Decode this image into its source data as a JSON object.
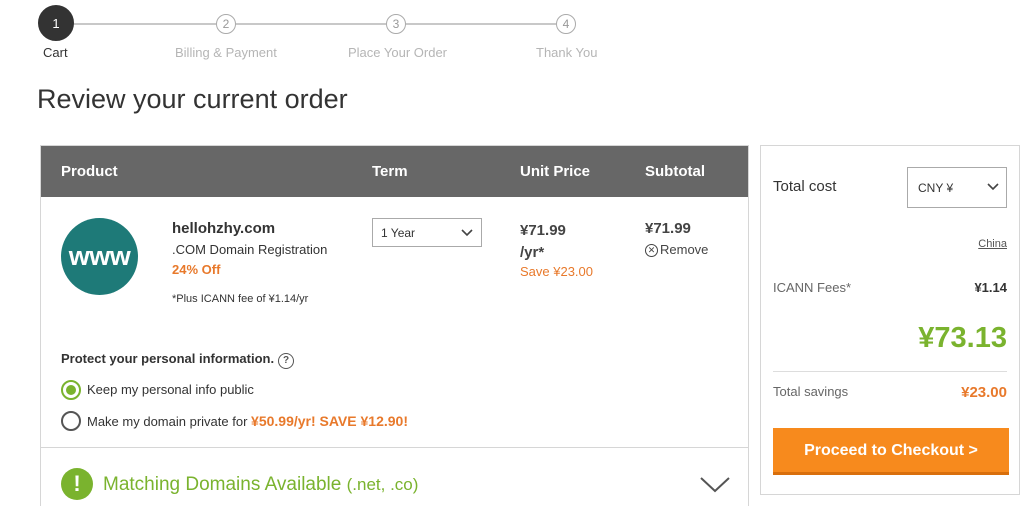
{
  "steps": [
    {
      "number": "1",
      "label": "Cart"
    },
    {
      "number": "2",
      "label": "Billing & Payment"
    },
    {
      "number": "3",
      "label": "Place Your Order"
    },
    {
      "number": "4",
      "label": "Thank You"
    }
  ],
  "page_title": "Review your current order",
  "table": {
    "headers": {
      "product": "Product",
      "term": "Term",
      "unit_price": "Unit Price",
      "subtotal": "Subtotal"
    }
  },
  "item": {
    "logo_text": "www",
    "domain": "hellohzhy.com",
    "description": ".COM Domain Registration",
    "discount": "24% Off",
    "icann_note": "*Plus ICANN fee of ¥1.14/yr",
    "term_value": "1 Year",
    "unit_price": "¥71.99 /yr*",
    "unit_save": "Save ¥23.00",
    "subtotal": "¥71.99",
    "remove_label": "Remove"
  },
  "privacy": {
    "title": "Protect your personal information.",
    "help_symbol": "?",
    "option_public": "Keep my personal info public",
    "option_private_prefix": "Make my domain private for",
    "option_private_price": "¥50.99/yr! SAVE ¥12.90!",
    "selected": "public"
  },
  "matching": {
    "icon_symbol": "!",
    "title": "Matching Domains Available",
    "extensions": "(.net, .co)"
  },
  "summary": {
    "total_cost_label": "Total cost",
    "currency_value": "CNY ¥",
    "country": "China",
    "icann_label": "ICANN Fees*",
    "icann_value": "¥1.14",
    "grand_total": "¥73.13",
    "savings_label": "Total savings",
    "savings_value": "¥23.00",
    "checkout_label": "Proceed to Checkout >"
  },
  "colors": {
    "accent_green": "#7ab32e",
    "accent_orange": "#e8792b",
    "checkout_orange": "#f78a1d",
    "header_gray": "#676767"
  }
}
